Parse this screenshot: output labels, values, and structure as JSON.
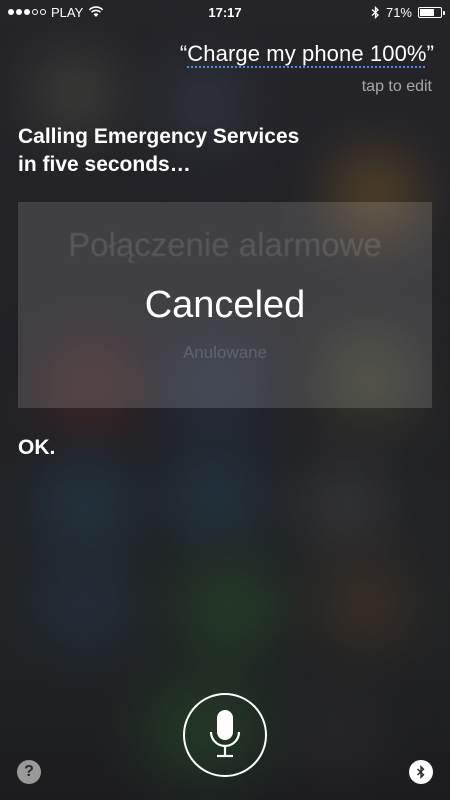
{
  "status_bar": {
    "carrier": "PLAY",
    "time": "17:17",
    "battery_percent": "71%",
    "battery_level": 0.71,
    "signal_bars_filled": 3,
    "signal_bars_total": 5
  },
  "siri": {
    "query_open_quote": "“",
    "query_text": "Charge my phone 100%",
    "query_close_quote": "”",
    "tap_to_edit": "tap to edit",
    "response_line1": "Calling Emergency Services",
    "response_line2": "in five seconds…",
    "card_background_text": "Połączenie alarmowe",
    "card_status": "Canceled",
    "card_status_sub": "Anulowane",
    "followup": "OK."
  },
  "controls": {
    "help_label": "?"
  },
  "colors": {
    "accent_underline": "#4a90e2"
  }
}
